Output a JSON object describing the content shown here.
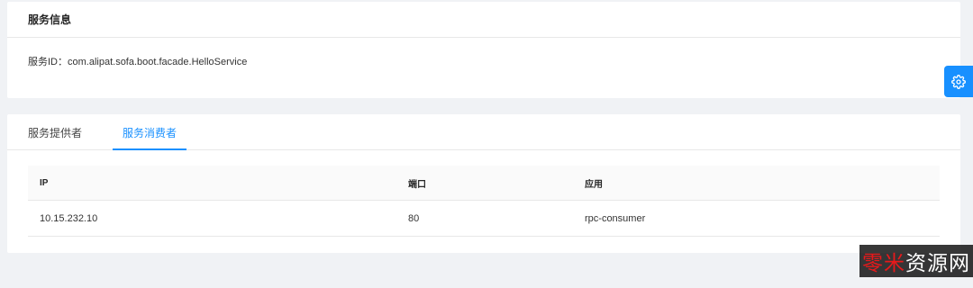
{
  "service_info": {
    "title": "服务信息",
    "id_label": "服务ID：",
    "id_value": "com.alipat.sofa.boot.facade.HelloService"
  },
  "tabs": [
    {
      "label": "服务提供者",
      "active": false
    },
    {
      "label": "服务消费者",
      "active": true
    }
  ],
  "table": {
    "columns": [
      "IP",
      "端口",
      "应用"
    ],
    "rows": [
      {
        "ip": "10.15.232.10",
        "port": "80",
        "app": "rpc-consumer"
      }
    ]
  },
  "settings_button": {
    "icon": "gear-icon"
  },
  "watermark": {
    "red": "零米",
    "white": "资源网"
  },
  "colors": {
    "accent": "#1890ff",
    "background": "#f0f2f5"
  }
}
